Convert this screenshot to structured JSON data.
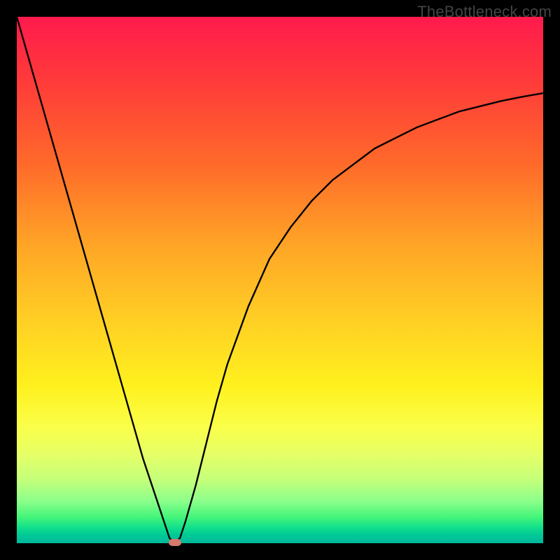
{
  "watermark": "TheBottleneck.com",
  "chart_data": {
    "type": "line",
    "title": "",
    "xlabel": "",
    "ylabel": "",
    "xlim": [
      0,
      100
    ],
    "ylim": [
      0,
      100
    ],
    "grid": false,
    "legend": false,
    "background_gradient": {
      "top": "#ff1a4d",
      "bottom": "#00b89c",
      "description": "vertical rainbow gradient red→orange→yellow→green"
    },
    "series": [
      {
        "name": "curve",
        "color": "#000000",
        "x": [
          0,
          2,
          4,
          6,
          8,
          10,
          12,
          14,
          16,
          18,
          20,
          22,
          24,
          26,
          28,
          29,
          30,
          31,
          32,
          34,
          36,
          38,
          40,
          44,
          48,
          52,
          56,
          60,
          64,
          68,
          72,
          76,
          80,
          84,
          88,
          92,
          96,
          100
        ],
        "y": [
          100,
          93,
          86,
          79,
          72,
          65,
          58,
          51,
          44,
          37,
          30,
          23,
          16,
          10,
          4,
          1,
          0,
          1,
          4,
          11,
          19,
          27,
          34,
          45,
          54,
          60,
          65,
          69,
          72,
          75,
          77,
          79,
          80.5,
          82,
          83,
          84,
          84.8,
          85.5
        ]
      }
    ],
    "marker": {
      "name": "optimal-point",
      "x": 30,
      "y": 0,
      "color": "#d6786a"
    }
  }
}
